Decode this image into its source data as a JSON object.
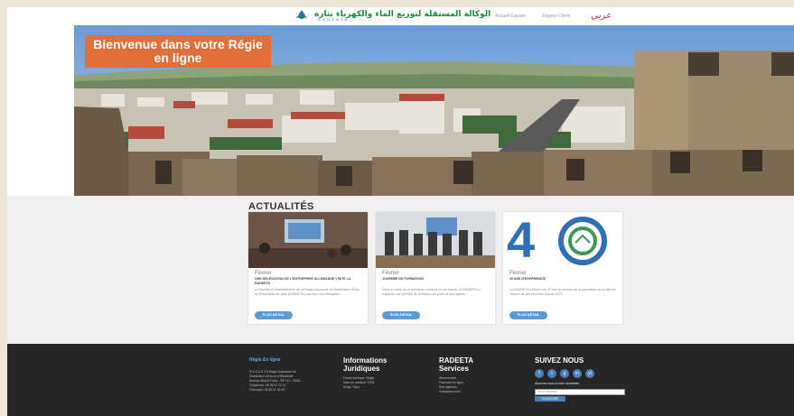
{
  "header": {
    "logo_arabic": "الوكالة المستقلة لتوزيع الماء والكهرباء بتازة",
    "logo_sub": "R.A.D.E.E.T.A",
    "nav": [
      "Accueil Espace",
      "Espace Client"
    ],
    "lang_label": "عربي"
  },
  "hero": {
    "banner_text": "Bienvenue dans votre Régie en ligne"
  },
  "news": {
    "section_title": "ACTUALITÉS",
    "cards": [
      {
        "date": "Février",
        "title": "UNE DÉLÉGATION DE L'ENTREPRISE ALLEMANDE VISITE LA RADEETA",
        "body": "La Société a l'Administration de la Régie Autonome de Distribution d'Eau et d'Électricité de Taza (RADEETA) ont reçu une délégation ...",
        "more_label": "PLUS DETAIL"
      },
      {
        "date": "Février",
        "title": "JOURNÉE DE FORMATION",
        "body": "Dans le cadre de la formation continue du personnel, la RADEETA a organisé une journée de formation au profit de ses agents ...",
        "more_label": "PLUS DETAIL"
      },
      {
        "date": "Février",
        "title": "40 ANS D'EXPÉRIENCE",
        "body": "La RADEETA célèbre ses 40 ans au service de la population de la ville de Taza et de ses environs depuis 1978 ...",
        "more_label": "PLUS DETAIL"
      }
    ]
  },
  "footer": {
    "col1": {
      "title": "Régie En ligne",
      "lines": [
        "R.A.D.E.E.T.A Régie Autonome de",
        "Distribution d'Eau et d'Électricité",
        "Avenue Allal Al Fassi - BP 111 - TAZA",
        "Téléphone: 05 35 67 12 11",
        "Télécopie: 05 35 67 40 34"
      ]
    },
    "col2": {
      "title": "Informations Juridiques",
      "lines": [
        "Forme juridique: Régie",
        "Date de création: 1978",
        "Siège: Taza"
      ]
    },
    "col3": {
      "title": "RADEETA Services",
      "lines": [
        "Abonnement",
        "Paiement en ligne",
        "Nos agences",
        "Contactez-nous"
      ]
    },
    "col4": {
      "title": "SUIVEZ NOUS",
      "socials": [
        "f",
        "t",
        "g",
        "in",
        "yt"
      ],
      "newsletter_text": "Abonnez-vous à notre newsletter",
      "newsletter_placeholder": "Votre adresse",
      "newsletter_btn": "S'INSCRIRE"
    }
  },
  "colors": {
    "banner": "#e06f3a",
    "footer": "#262626",
    "accent": "#5b9bd5"
  }
}
